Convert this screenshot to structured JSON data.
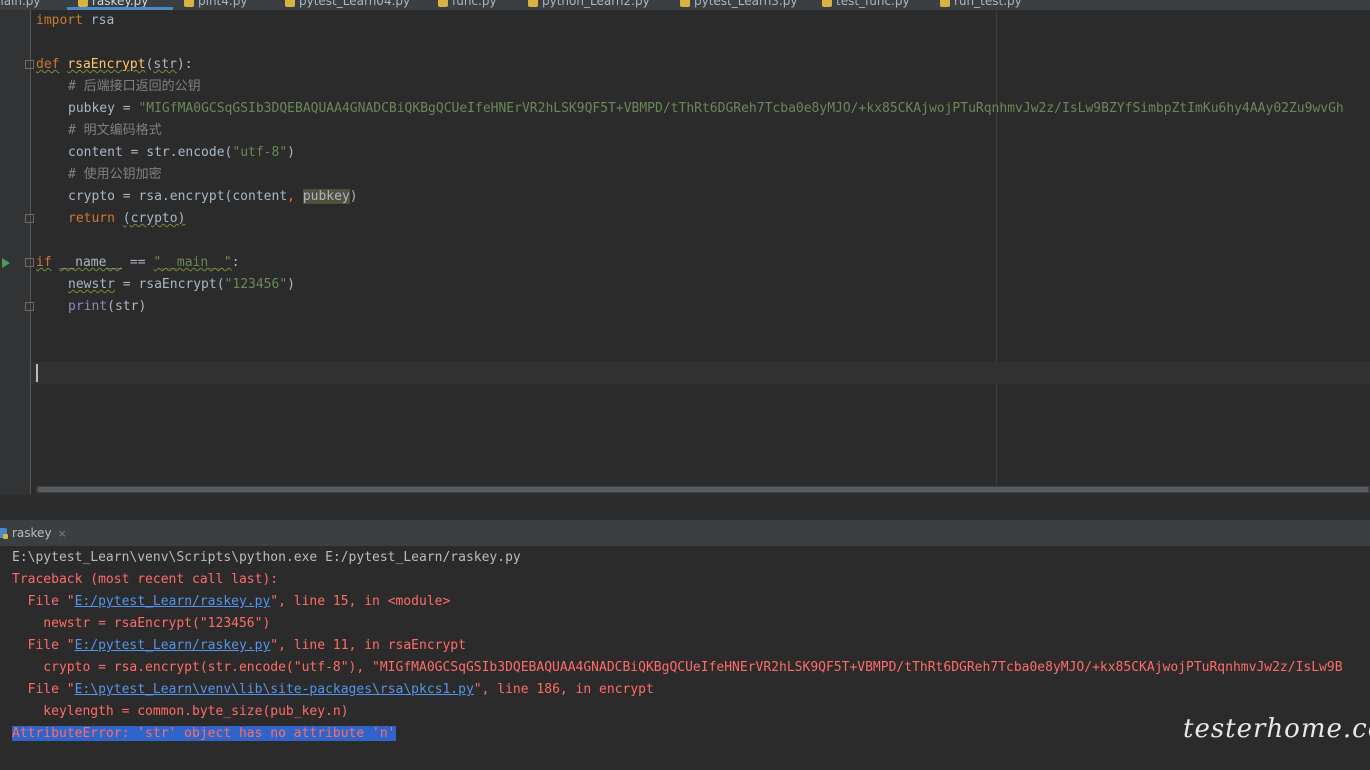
{
  "tabs": [
    {
      "label": "main.py",
      "active": false
    },
    {
      "label": "raskey.py",
      "active": true
    },
    {
      "label": "pint4.py",
      "active": false
    },
    {
      "label": "pytest_Learn04.py",
      "active": false
    },
    {
      "label": "func.py",
      "active": false
    },
    {
      "label": "python_Learn2.py",
      "active": false
    },
    {
      "label": "pytest_Learn3.py",
      "active": false
    },
    {
      "label": "test_func.py",
      "active": false
    },
    {
      "label": "run_test.py",
      "active": false
    }
  ],
  "code": {
    "line1": {
      "kw": "import",
      "rest": " rsa"
    },
    "line3": {
      "kw": "def",
      "fn": "rsaEncrypt",
      "open": "(",
      "param": "str",
      "close": "):"
    },
    "line4": {
      "comment": "# 后端接口返回的公钥"
    },
    "line5": {
      "var": "pubkey = ",
      "str": "\"MIGfMA0GCSqGSIb3DQEBAQUAA4GNADCBiQKBgQCUeIfeHNErVR2hLSK9QF5T+VBMPD/tThRt6DGReh7Tcba0e8yMJO/+kx85CKAjwojPTuRqnhmvJw2z/IsLw9BZYfSimbpZtImKu6hy4AAy02Zu9wvGh"
    },
    "line6": {
      "comment": "# 明文编码格式"
    },
    "line7": {
      "pre": "content = str.encode(",
      "str": "\"utf-8\"",
      "post": ")"
    },
    "line8": {
      "comment": "# 使用公钥加密"
    },
    "line9": {
      "pre": "crypto = rsa.encrypt(content",
      "comma": ", ",
      "arg": "pubkey",
      "post": ")"
    },
    "line10": {
      "kw": "return",
      "rest": "(crypto)"
    },
    "line12": {
      "kw": "if",
      "name": "__name__",
      "eq": " == ",
      "str": "\"__main__\"",
      "colon": ":"
    },
    "line13": {
      "var": "newstr",
      "pre": " = rsaEncrypt(",
      "str": "\"123456\"",
      "post": ")"
    },
    "line14": {
      "builtin": "print",
      "rest": "(str)"
    }
  },
  "run_panel": {
    "tab_label": "raskey",
    "close_glyph": "×"
  },
  "console": {
    "cmd": "E:\\pytest_Learn\\venv\\Scripts\\python.exe E:/pytest_Learn/raskey.py",
    "traceback_header": "Traceback (most recent call last):",
    "frames": [
      {
        "file_pre": "  File \"",
        "path": "E:/pytest_Learn/raskey.py",
        "file_post": "\", line 15, in <module>",
        "src": "    newstr = rsaEncrypt(\"123456\")"
      },
      {
        "file_pre": "  File \"",
        "path": "E:/pytest_Learn/raskey.py",
        "file_post": "\", line 11, in rsaEncrypt",
        "src": "    crypto = rsa.encrypt(str.encode(\"utf-8\"), \"MIGfMA0GCSqGSIb3DQEBAQUAA4GNADCBiQKBgQCUeIfeHNErVR2hLSK9QF5T+VBMPD/tThRt6DGReh7Tcba0e8yMJO/+kx85CKAjwojPTuRqnhmvJw2z/IsLw9B"
      },
      {
        "file_pre": "  File \"",
        "path": "E:\\pytest_Learn\\venv\\lib\\site-packages\\rsa\\pkcs1.py",
        "file_post": "\", line 186, in encrypt",
        "src": "    keylength = common.byte_size(pub_key.n)"
      }
    ],
    "error": "AttributeError: 'str' object has no attribute 'n'"
  },
  "watermark": "testerhome.com",
  "colors": {
    "keyword": "#cc7832",
    "function": "#ffc66d",
    "string": "#6a8759",
    "comment": "#808080",
    "error": "#ff6b68",
    "link": "#5394ec",
    "selection": "#2f65ca"
  }
}
